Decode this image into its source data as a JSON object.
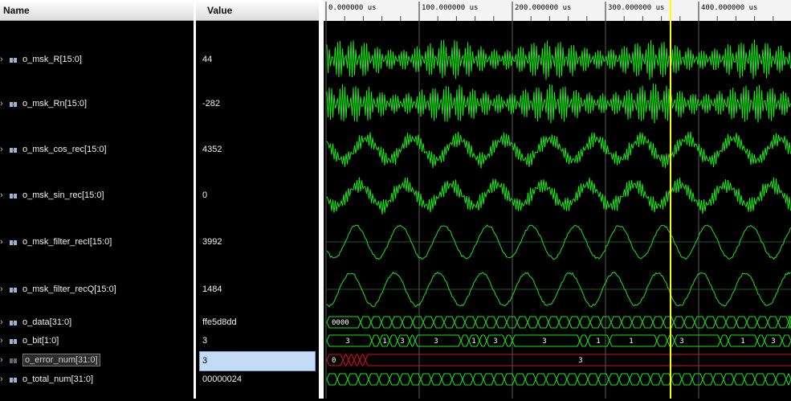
{
  "columns": {
    "name": "Name",
    "value": "Value"
  },
  "timeline": {
    "ticks": [
      "0.000000 us",
      "100.000000 us",
      "200.000000 us",
      "300.000000 us",
      "400.000000 us"
    ]
  },
  "signals": [
    {
      "name": "o_msk_R[15:0]",
      "value": "44",
      "icon": "bus-icon"
    },
    {
      "name": "o_msk_Rn[15:0]",
      "value": "-282",
      "icon": "bus-icon"
    },
    {
      "name": "o_msk_cos_rec[15:0]",
      "value": "4352",
      "icon": "bus-icon"
    },
    {
      "name": "o_msk_sin_rec[15:0]",
      "value": "0",
      "icon": "bus-icon"
    },
    {
      "name": "o_msk_filter_recI[15:0]",
      "value": "3992",
      "icon": "bus-icon"
    },
    {
      "name": "o_msk_filter_recQ[15:0]",
      "value": "1484",
      "icon": "bus-icon"
    },
    {
      "name": "o_data[31:0]",
      "value": "ffe5d8dd",
      "icon": "bus-icon"
    },
    {
      "name": "o_bit[1:0]",
      "value": "3",
      "icon": "bus-icon"
    },
    {
      "name": "o_error_num[31:0]",
      "value": "3",
      "icon": "bus-icon",
      "selected": true
    },
    {
      "name": "o_total_num[31:0]",
      "value": "00000024",
      "icon": "bus-icon"
    }
  ],
  "bus_labels": {
    "o_data": [
      "0000"
    ],
    "o_bit": [
      "3",
      "1",
      "3",
      "3",
      "1",
      "3",
      "3",
      "1",
      "1",
      "3",
      "1",
      "3",
      "1",
      "3"
    ],
    "o_error_num": [
      "0",
      "3"
    ]
  },
  "colors": {
    "wave": "#19e619",
    "error": "#e01010",
    "cursor": "#ffff00",
    "selection": "#c5dbf5"
  }
}
